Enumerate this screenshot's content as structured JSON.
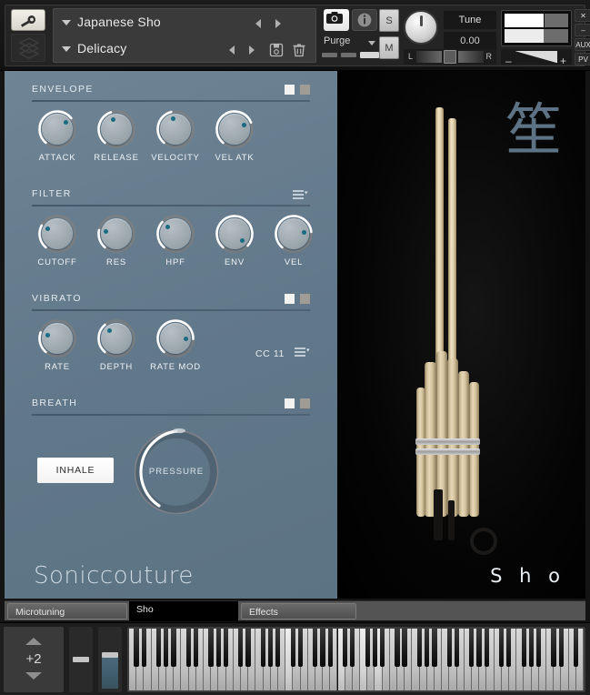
{
  "header": {
    "wrench_icon": "wrench-icon",
    "logo_icon": "soniccouture-logo-icon",
    "instrument_name": "Japanese Sho",
    "preset_name": "Delicacy",
    "camera_icon": "camera-icon",
    "info_icon": "info-icon",
    "save_icon": "save-icon",
    "trash_icon": "trash-icon",
    "purge_label": "Purge",
    "solo_label": "S",
    "mute_label": "M",
    "tune_label": "Tune",
    "tune_value": "0.00",
    "pan_left": "L",
    "pan_right": "R",
    "vol_minus": "–",
    "vol_plus": "+",
    "edge_buttons": [
      {
        "label": "✕",
        "name": "close-button"
      },
      {
        "label": "–",
        "name": "minimize-button"
      },
      {
        "label": "AUX",
        "name": "aux-button"
      },
      {
        "label": "PV",
        "name": "pv-button"
      }
    ],
    "meter_fill_percent": 62
  },
  "sections": {
    "envelope": {
      "title": "ENVELOPE",
      "toggle_on": true,
      "knobs": [
        {
          "label": "ATTACK",
          "angle": 52
        },
        {
          "label": "RELEASE",
          "angle": -18
        },
        {
          "label": "VELOCITY",
          "angle": -14
        },
        {
          "label": "VEL ATK",
          "angle": 68
        }
      ]
    },
    "filter": {
      "title": "FILTER",
      "menu_icon": "filter-menu-icon",
      "knobs": [
        {
          "label": "CUTOFF",
          "angle": -62
        },
        {
          "label": "RES",
          "angle": -78
        },
        {
          "label": "HPF",
          "angle": -48
        },
        {
          "label": "ENV",
          "angle": 132
        },
        {
          "label": "VEL",
          "angle": 84
        }
      ]
    },
    "vibrato": {
      "title": "VIBRATO",
      "toggle_on": true,
      "knobs": [
        {
          "label": "RATE",
          "angle": -70
        },
        {
          "label": "DEPTH",
          "angle": -40
        },
        {
          "label": "RATE MOD",
          "angle": 92
        }
      ],
      "cc_label": "CC 11",
      "cc_menu_icon": "cc-menu-icon"
    },
    "breath": {
      "title": "BREATH",
      "toggle_on": true,
      "inhale_label": "INHALE",
      "pressure_label": "PRESSURE"
    }
  },
  "brand": "Soniccouture",
  "instrument_display": "S h o",
  "kanji": "笙",
  "tabs": [
    {
      "label": "Microtuning",
      "active": false
    },
    {
      "label": "Sho",
      "active": true
    },
    {
      "label": "Effects",
      "active": false
    }
  ],
  "keyboard": {
    "octave_value": "+2",
    "octave_up_icon": "triangle-up-icon",
    "octave_down_icon": "triangle-down-icon",
    "pitch_bend_name": "pitch-bend-slider",
    "mod_wheel_name": "mod-wheel-slider"
  },
  "colors": {
    "panel": "#62798a",
    "accent_dot": "#1b6b82",
    "knob_arc": "#ffffff",
    "kanji": "#5d7385"
  }
}
